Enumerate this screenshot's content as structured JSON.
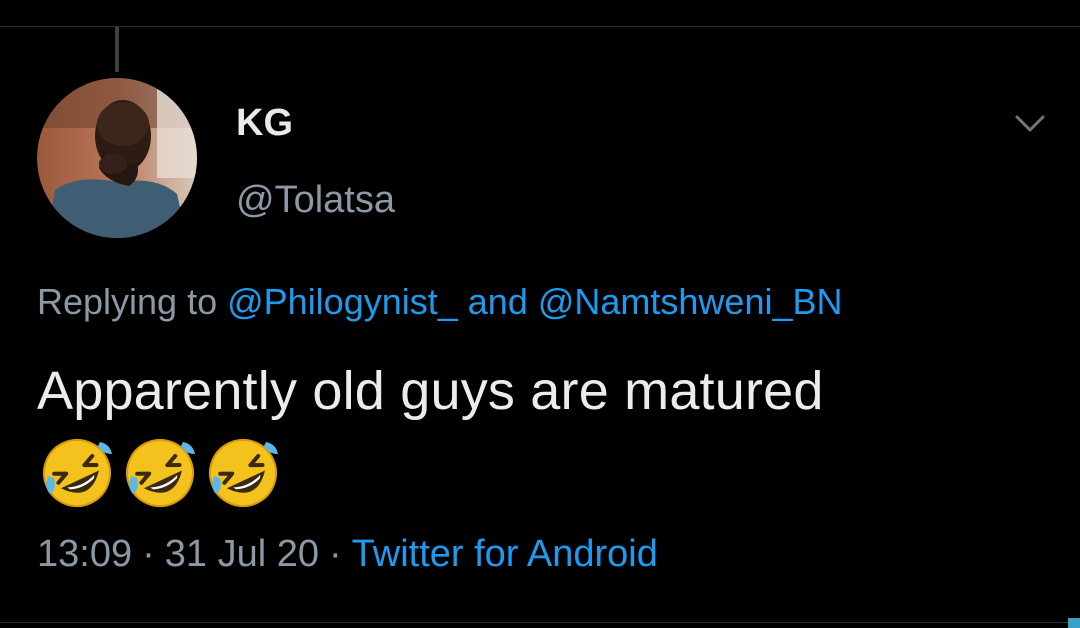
{
  "tweet": {
    "author": {
      "display_name": "KG",
      "handle": "@Tolatsa"
    },
    "reply_context": {
      "prefix": "Replying to ",
      "mention_1": "@Philogynist_",
      "joiner": " and ",
      "mention_2": "@Namtshweni_BN"
    },
    "text": "Apparently old guys are matured",
    "emojis": [
      "rolling-on-floor-laughing-emoji",
      "rolling-on-floor-laughing-emoji",
      "rolling-on-floor-laughing-emoji"
    ],
    "time": "13:09",
    "separator": "·",
    "date": "31 Jul 20",
    "source": "Twitter for Android"
  },
  "colors": {
    "background": "#000000",
    "primary_text": "#e6e6e6",
    "secondary_text": "#8b98a5",
    "link": "#1d9bf0"
  },
  "icons": {
    "more": "chevron-down-icon"
  }
}
